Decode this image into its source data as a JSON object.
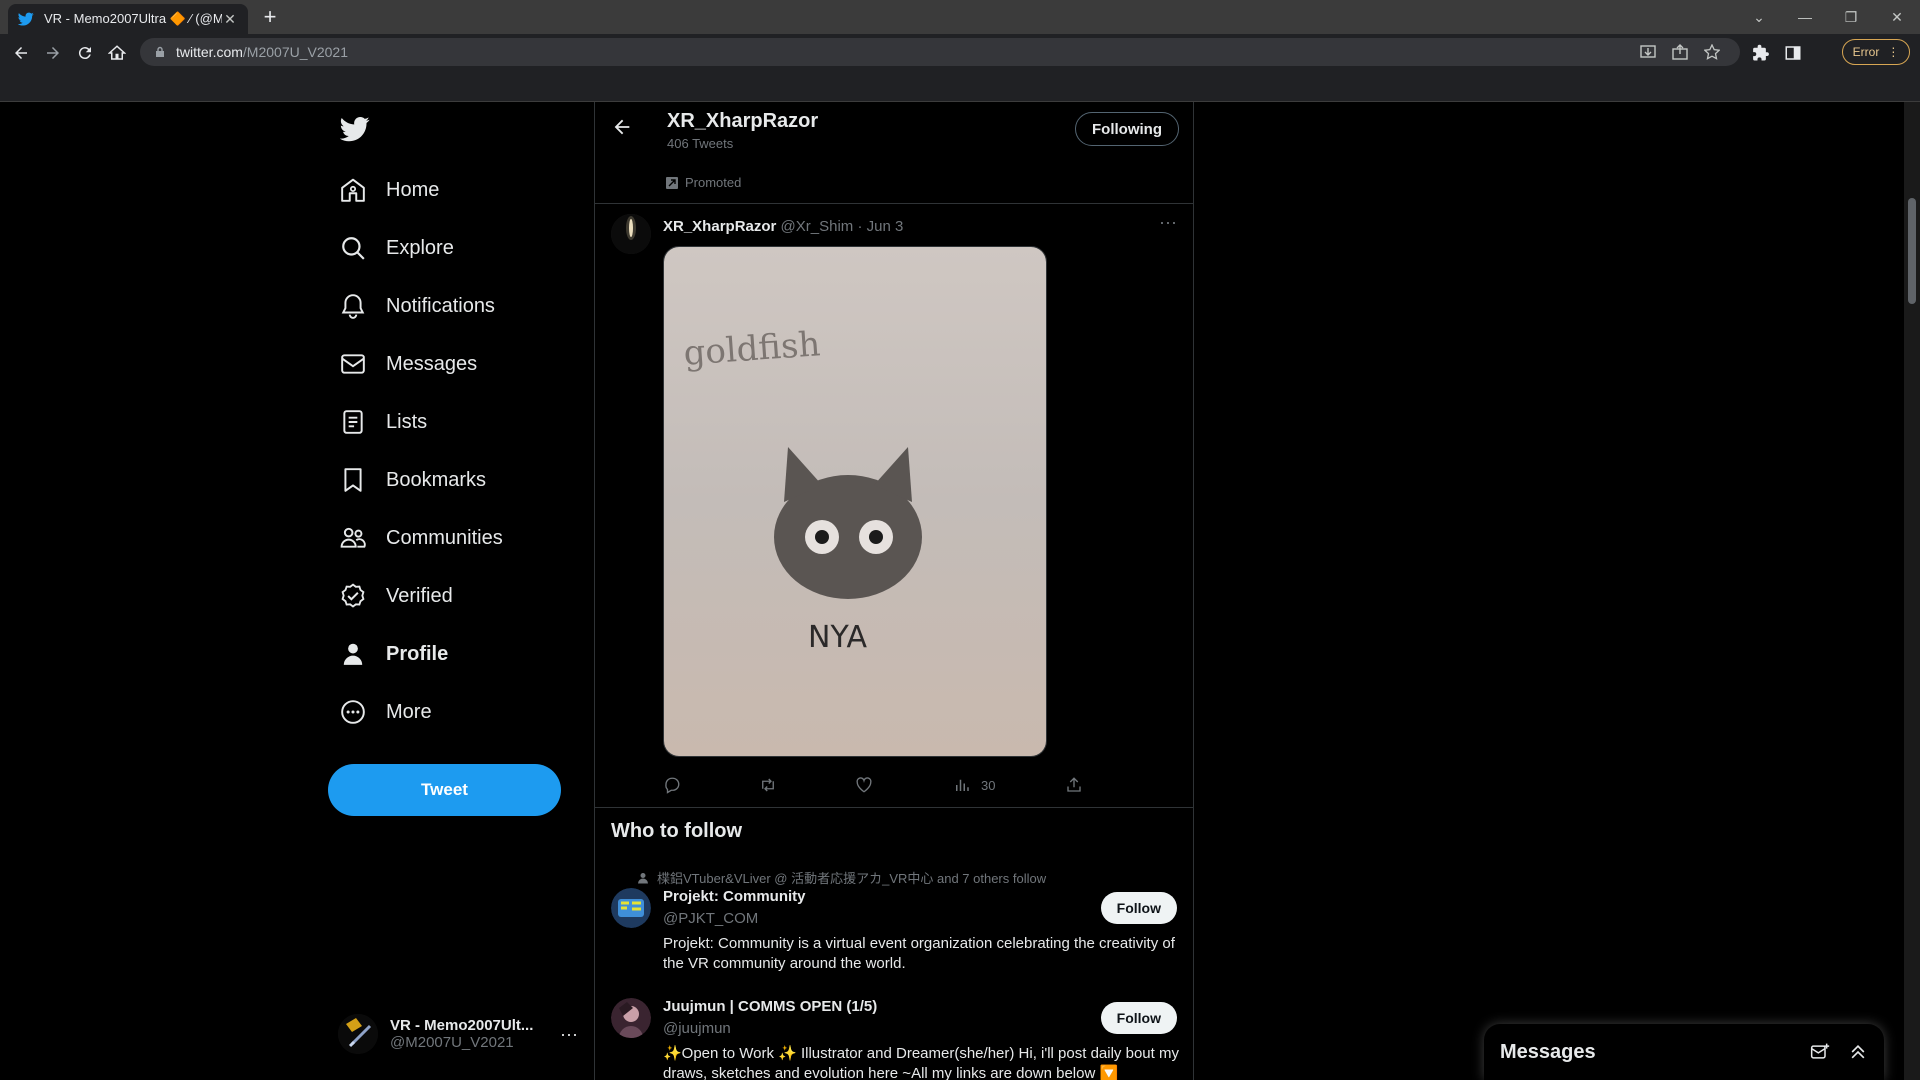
{
  "browser": {
    "tab_title": "VR - Memo2007Ultra 🔶 ⁄ (@M",
    "url_host": "twitter.com",
    "url_path": "/M2007U_V2021",
    "error_label": "Error"
  },
  "nav": {
    "home": "Home",
    "explore": "Explore",
    "notifications": "Notifications",
    "messages": "Messages",
    "lists": "Lists",
    "bookmarks": "Bookmarks",
    "communities": "Communities",
    "verified": "Verified",
    "profile": "Profile",
    "more": "More",
    "tweet_button": "Tweet"
  },
  "account": {
    "name": "VR - Memo2007Ult...",
    "handle": "@M2007U_V2021"
  },
  "header": {
    "name": "XR_XharpRazor",
    "tweet_count": "406 Tweets",
    "following_label": "Following"
  },
  "promoted_label": "Promoted",
  "tweet": {
    "author_name": "XR_XharpRazor",
    "author_meta": "@Xr_Shim · Jun 3",
    "image_text_top": "goldfish",
    "image_text_bottom": "NYA",
    "views": "30"
  },
  "who_to_follow": {
    "title": "Who to follow",
    "follow_label": "Follow",
    "users": [
      {
        "social_context": "楪鋁VTuber&VLiver @ 活動者応援アカ_VR中心 and 7 others follow",
        "name": "Projekt: Community",
        "handle": "@PJKT_COM",
        "bio": "Projekt: Community is a virtual event organization celebrating the creativity of the VR community around the world."
      },
      {
        "name": "Juujmun | COMMS OPEN (1/5)",
        "handle": "@juujmun",
        "bio": "✨Open to Work ✨ Illustrator and Dreamer(she/her) Hi, i'll post daily bout my draws, sketches and evolution here ~All my links are down below 🔽"
      }
    ]
  },
  "messages_drawer": {
    "title": "Messages"
  }
}
